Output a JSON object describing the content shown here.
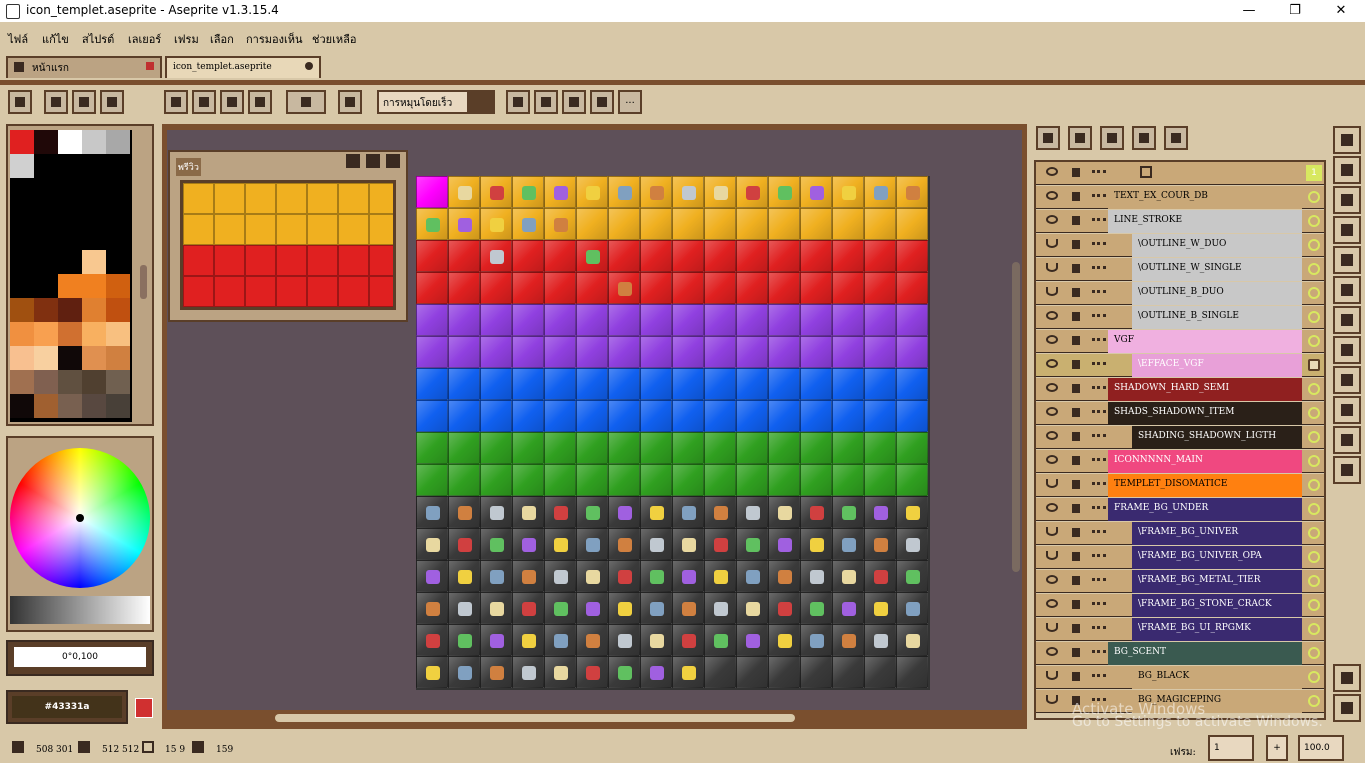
{
  "window": {
    "title": "icon_templet.aseprite - Aseprite v1.3.15.4",
    "minimize": "—",
    "maximize": "❐",
    "close": "✕"
  },
  "menu": [
    "ไฟล์",
    "แก้ไข",
    "สไปรต์",
    "เลเยอร์",
    "เฟรม",
    "เลือก",
    "การมองเห็น",
    "ช่วยเหลือ"
  ],
  "tabs": [
    {
      "label": "หน้าแรก"
    },
    {
      "label": "icon_templet.aseprite"
    }
  ],
  "toolbar": {
    "rotation_mode": "การหมุนโดยเร็ว",
    "more": "..."
  },
  "preview": {
    "title": "พรีวิว"
  },
  "color": {
    "hsv_value": "0°0,100",
    "hex_value": "#43331a"
  },
  "layers": [
    {
      "name": "TEXT_EX_COUR_DB",
      "bg": "#c9a878",
      "indent": 0,
      "visible": true,
      "group": false
    },
    {
      "name": "LINE_STROKE",
      "bg": "#c8c8c8",
      "indent": 0,
      "visible": true,
      "group": true
    },
    {
      "name": "\\OUTLINE_W_DUO",
      "bg": "#c8c8c8",
      "indent": 1,
      "visible": false,
      "group": false
    },
    {
      "name": "\\OUTLINE_W_SINGLE",
      "bg": "#c8c8c8",
      "indent": 1,
      "visible": false,
      "group": false
    },
    {
      "name": "\\OUTLINE_B_DUO",
      "bg": "#c8c8c8",
      "indent": 1,
      "visible": false,
      "group": false
    },
    {
      "name": "\\OUTLINE_B_SINGLE",
      "bg": "#c8c8c8",
      "indent": 1,
      "visible": true,
      "group": false
    },
    {
      "name": "VGF",
      "bg": "#f0b0e0",
      "indent": 0,
      "visible": true,
      "group": true
    },
    {
      "name": "\\EFFACE_VGF",
      "bg": "#e8a0d8",
      "indent": 1,
      "visible": true,
      "group": false,
      "selected": true
    },
    {
      "name": "SHADOWN_HARD_SEMI",
      "bg": "#902020",
      "indent": 0,
      "visible": true,
      "group": false
    },
    {
      "name": "SHADS_SHADOWN_ITEM",
      "bg": "#2a2018",
      "indent": 0,
      "visible": true,
      "group": true
    },
    {
      "name": "SHADING_SHADOWN_LIGTH",
      "bg": "#2a2018",
      "indent": 1,
      "visible": true,
      "group": false
    },
    {
      "name": "ICONNNNN_MAIN",
      "bg": "#f04880",
      "indent": 0,
      "visible": true,
      "group": false
    },
    {
      "name": "TEMPLET_DISOMATICE",
      "bg": "#ff8010",
      "indent": 0,
      "visible": false,
      "group": false
    },
    {
      "name": "FRAME_BG_UNDER",
      "bg": "#3a2a70",
      "indent": 0,
      "visible": true,
      "group": true
    },
    {
      "name": "\\FRAME_BG_UNIVER",
      "bg": "#3a2a70",
      "indent": 1,
      "visible": false,
      "group": false
    },
    {
      "name": "\\FRAME_BG_UNIVER_OPA",
      "bg": "#3a2a70",
      "indent": 1,
      "visible": false,
      "group": false
    },
    {
      "name": "\\FRAME_BG_METAL_TIER",
      "bg": "#3a2a70",
      "indent": 1,
      "visible": true,
      "group": false
    },
    {
      "name": "\\FRAME_BG_STONE_CRACK",
      "bg": "#3a2a70",
      "indent": 1,
      "visible": true,
      "group": false
    },
    {
      "name": "\\FRAME_BG_UI_RPGMK",
      "bg": "#3a2a70",
      "indent": 1,
      "visible": false,
      "group": false
    },
    {
      "name": "BG_SCENT",
      "bg": "#3a5a50",
      "indent": 0,
      "visible": true,
      "group": true
    },
    {
      "name": "BG_BLACK",
      "bg": "#c9a878",
      "indent": 1,
      "visible": false,
      "group": false
    },
    {
      "name": "BG_MAGICEPING",
      "bg": "#c9a878",
      "indent": 1,
      "visible": false,
      "group": false
    }
  ],
  "frame_header": {
    "frame_number": "1"
  },
  "status": {
    "cursor_pos": "508 301",
    "sprite_size": "512 512",
    "grid": "15 9",
    "zoom_frames": "159",
    "frame_label": "เฟรม:",
    "frame_value": "1",
    "zoom_value": "100.0",
    "plus": "+"
  },
  "watermark": {
    "line1": "Activate Windows",
    "line2": "Go to Settings to activate Windows."
  },
  "sprite_rows": [
    "#f0b020",
    "#f0b020",
    "#e02020",
    "#e02020",
    "#9040e0",
    "#9040e0",
    "#1060f0",
    "#1060f0",
    "#30a020",
    "#30a020",
    "#3a3a3a",
    "#3a3a3a",
    "#3a3a3a",
    "#3a3a3a",
    "#3a3a3a",
    "#3a3a3a"
  ]
}
